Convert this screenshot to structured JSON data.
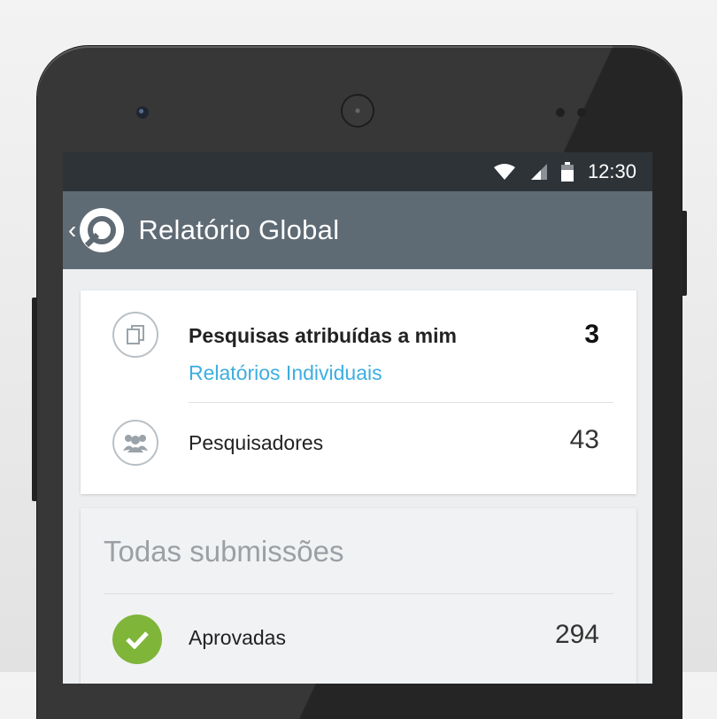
{
  "status_bar": {
    "time": "12:30"
  },
  "app_bar": {
    "back_icon": "chevron-left-icon",
    "logo_icon": "app-logo-icon",
    "title": "Relatório Global"
  },
  "summary_card": {
    "assigned": {
      "icon": "documents-icon",
      "label": "Pesquisas atribuídas a mim",
      "value": "3",
      "link": "Relatórios Individuais"
    },
    "researchers": {
      "icon": "group-icon",
      "label": "Pesquisadores",
      "value": "43"
    }
  },
  "submissions_card": {
    "title": "Todas submissões",
    "approved": {
      "icon": "check-icon",
      "label": "Aprovadas",
      "value": "294",
      "color": "#7fb539"
    }
  },
  "colors": {
    "appbar": "#5f6b74",
    "statusbar": "#2e3337",
    "link": "#3daee0"
  }
}
